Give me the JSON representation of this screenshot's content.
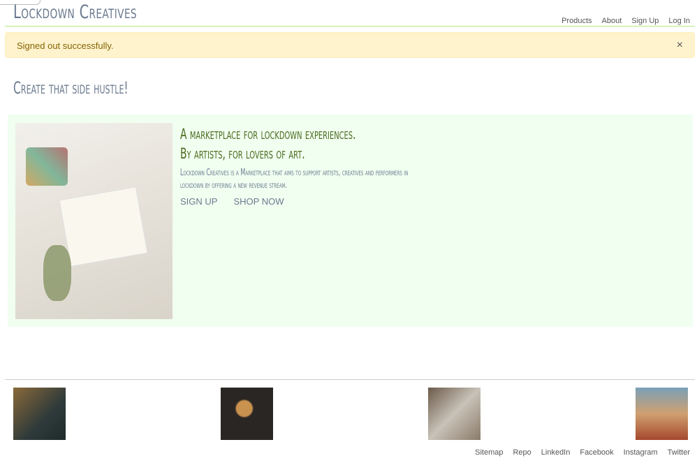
{
  "header": {
    "brand": "Lockdown Creatives",
    "nav": [
      "Products",
      "About",
      "Sign Up",
      "Log In"
    ]
  },
  "alert": {
    "message": "Signed out successfully.",
    "close": "×"
  },
  "page_title": "Create that side hustle!",
  "hero": {
    "heading_line1": "A marketplace for lockdown experiences.",
    "heading_line2": "By artists, for lovers of art.",
    "description": "Lockdown Creatives is a Marketplace that aims to support artists, creatives and performers in lockdown by offering a new revenue stream.",
    "sign_up": "SIGN UP",
    "shop_now": "SHOP NOW"
  },
  "footer": {
    "links": [
      "Sitemap",
      "Repo",
      "LinkedIn",
      "Facebook",
      "Instagram",
      "Twitter"
    ]
  }
}
